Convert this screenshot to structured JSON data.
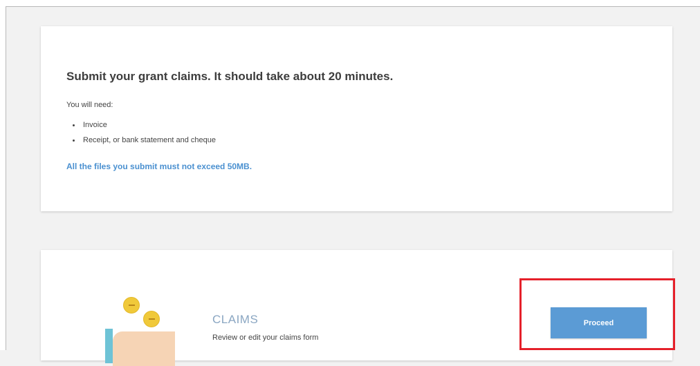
{
  "intro": {
    "title": "Submit your grant claims. It should take about 20 minutes.",
    "need_label": "You will need:",
    "items": [
      "Invoice",
      "Receipt, or bank statement and cheque"
    ],
    "note": "All the files you submit must not exceed 50MB."
  },
  "claims": {
    "title": "CLAIMS",
    "subtitle": "Review or edit your claims form",
    "proceed_label": "Proceed"
  },
  "colors": {
    "page_background": "#f2f2f2",
    "card_background": "#ffffff",
    "note_text": "#4a90d0",
    "claims_title": "#8aa6c2",
    "button": "#5b9bd5",
    "highlight": "#e5202a"
  },
  "icons": [
    "coins-in-hand-illustration"
  ]
}
